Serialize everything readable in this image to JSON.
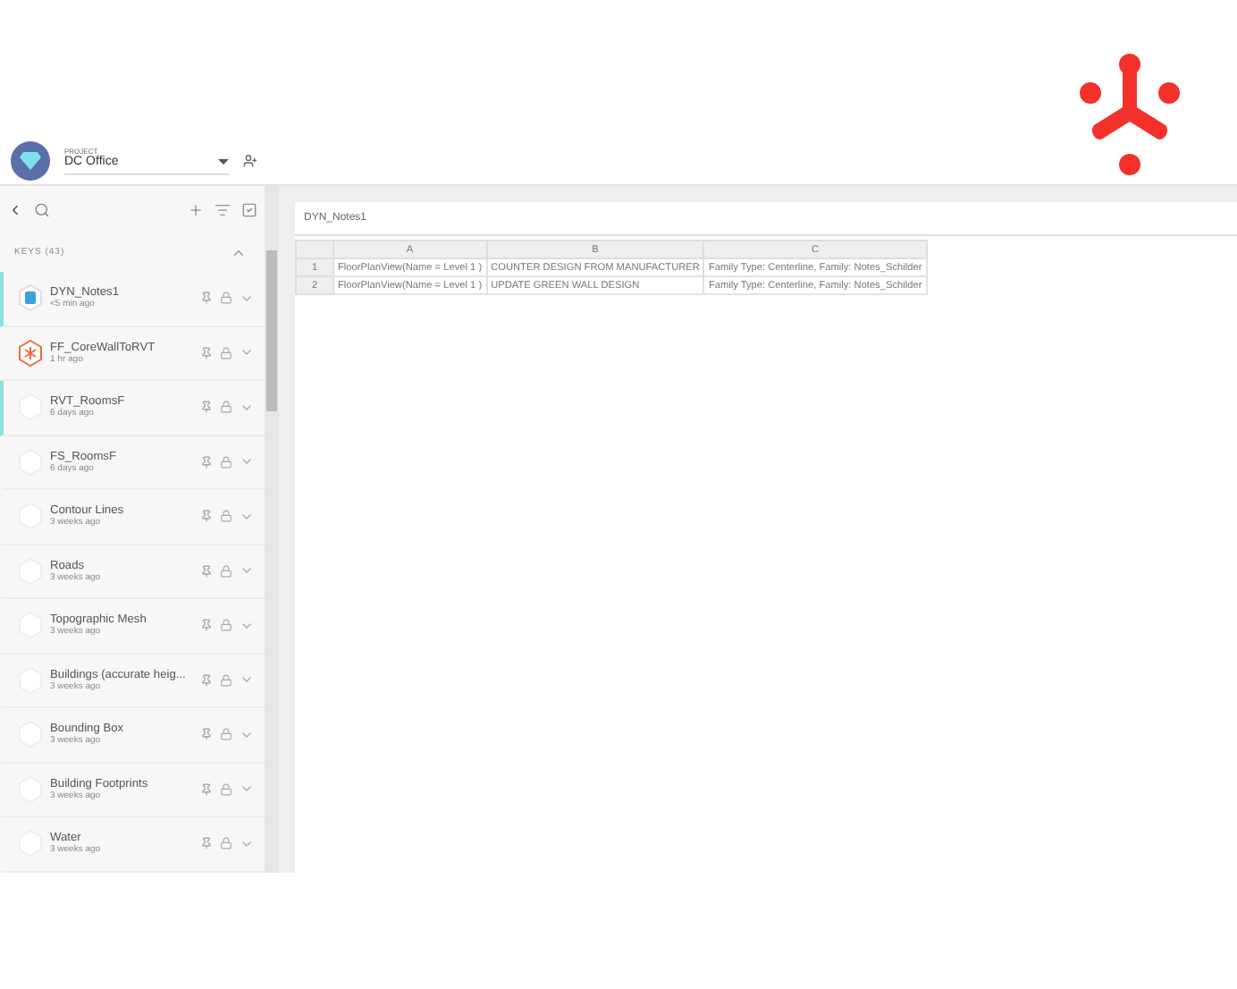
{
  "project": {
    "label": "PROJECT",
    "name": "DC Office"
  },
  "sidebar": {
    "keys_header": "KEYS (43)",
    "items": [
      {
        "name": "DYN_Notes1",
        "time": "<5 min ago",
        "kind": "dynamo",
        "highlighted": true
      },
      {
        "name": "FF_CoreWallToRVT",
        "time": "1 hr ago",
        "kind": "flux",
        "highlighted": false
      },
      {
        "name": "RVT_RoomsF",
        "time": "6 days ago",
        "kind": "empty",
        "highlighted": true
      },
      {
        "name": "FS_RoomsF",
        "time": "6 days ago",
        "kind": "empty",
        "highlighted": false
      },
      {
        "name": "Contour Lines",
        "time": "3 weeks ago",
        "kind": "empty",
        "highlighted": false
      },
      {
        "name": "Roads",
        "time": "3 weeks ago",
        "kind": "empty",
        "highlighted": false
      },
      {
        "name": "Topographic Mesh",
        "time": "3 weeks ago",
        "kind": "empty",
        "highlighted": false
      },
      {
        "name": "Buildings (accurate heig...",
        "time": "3 weeks ago",
        "kind": "empty",
        "highlighted": false
      },
      {
        "name": "Bounding Box",
        "time": "3 weeks ago",
        "kind": "empty",
        "highlighted": false
      },
      {
        "name": "Building Footprints",
        "time": "3 weeks ago",
        "kind": "empty",
        "highlighted": false
      },
      {
        "name": "Water",
        "time": "3 weeks ago",
        "kind": "empty",
        "highlighted": false
      }
    ]
  },
  "sheet": {
    "title": "DYN_Notes1",
    "columns": [
      "A",
      "B",
      "C"
    ],
    "rows": [
      {
        "number": "1",
        "cells": [
          "FloorPlanView(Name = Level 1 )",
          "COUNTER DESIGN FROM MANUFACTURER",
          "Family Type: Centerline, Family: Notes_Schilder"
        ]
      },
      {
        "number": "2",
        "cells": [
          "FloorPlanView(Name = Level 1 )",
          "UPDATE GREEN WALL DESIGN",
          "Family Type: Centerline, Family: Notes_Schilder"
        ]
      }
    ]
  }
}
